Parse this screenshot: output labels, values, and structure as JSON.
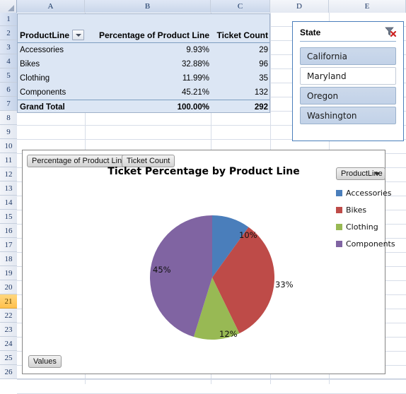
{
  "sheet": {
    "column_headers": [
      "A",
      "B",
      "C",
      "D",
      "E"
    ],
    "row_headers": [
      "1",
      "2",
      "3",
      "4",
      "5",
      "6",
      "7",
      "8",
      "9",
      "10",
      "11",
      "12",
      "13",
      "14",
      "15",
      "16",
      "17",
      "18",
      "19",
      "20",
      "21",
      "22",
      "23",
      "24",
      "25",
      "26"
    ],
    "active_row": "21",
    "select_all_icon": "select-all-corner-icon"
  },
  "pivot_table": {
    "headers": {
      "product_line": "ProductLine",
      "percentage": "Percentage of Product Line",
      "ticket_count": "Ticket Count"
    },
    "filter_icon": "filter-dropdown-icon",
    "rows": [
      {
        "product_line": "Accessories",
        "percentage": "9.93%",
        "ticket_count": "29"
      },
      {
        "product_line": "Bikes",
        "percentage": "32.88%",
        "ticket_count": "96"
      },
      {
        "product_line": "Clothing",
        "percentage": "11.99%",
        "ticket_count": "35"
      },
      {
        "product_line": "Components",
        "percentage": "45.21%",
        "ticket_count": "132"
      }
    ],
    "grand_total": {
      "label": "Grand Total",
      "percentage": "100.00%",
      "ticket_count": "292"
    }
  },
  "slicer": {
    "title": "State",
    "clear_filter_icon": "clear-filter-icon",
    "items": [
      {
        "label": "California",
        "selected": true
      },
      {
        "label": "Maryland",
        "selected": false
      },
      {
        "label": "Oregon",
        "selected": true
      },
      {
        "label": "Washington",
        "selected": true
      }
    ]
  },
  "chart": {
    "field_buttons": [
      "Percentage of Product Line",
      "Ticket Count"
    ],
    "values_button": "Values",
    "legend_button": {
      "label": "ProductLine",
      "icon": "chevron-down-icon"
    }
  },
  "chart_data": {
    "type": "pie",
    "title": "Ticket Percentage by Product Line",
    "categories": [
      "Accessories",
      "Bikes",
      "Clothing",
      "Components"
    ],
    "values": [
      9.93,
      32.88,
      11.99,
      45.21
    ],
    "data_labels": [
      "10%",
      "33%",
      "12%",
      "45%"
    ],
    "counts": [
      29,
      96,
      35,
      132
    ],
    "total_count": 292,
    "colors": [
      "#4a7ebb",
      "#be4b48",
      "#98b954",
      "#8064a2"
    ],
    "legend_position": "right",
    "legend_title": "ProductLine",
    "start_angle_deg": 0,
    "grid": false
  }
}
